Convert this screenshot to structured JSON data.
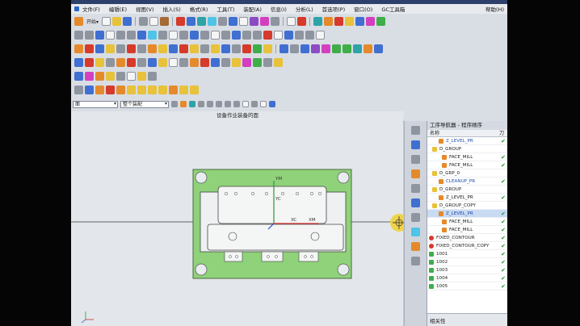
{
  "menu": {
    "items": [
      "文件(F)",
      "编辑(E)",
      "视图(V)",
      "插入(S)",
      "格式(R)",
      "工具(T)",
      "装配(A)",
      "信息(I)",
      "分析(L)",
      "首选项(P)",
      "窗口(O)",
      "GC工具箱",
      "帮助(H)"
    ]
  },
  "toolbar": {
    "start_label": "开始▾"
  },
  "filter": {
    "type_value": "面",
    "scope_value": "整个装配"
  },
  "viewport": {
    "title": "设备作业装备的面"
  },
  "triad": {
    "ym": "YM",
    "yc": "YC",
    "xc": "XC",
    "xm": "XM"
  },
  "navigator": {
    "title": "工序导航器 - 程序顺序",
    "col_name": "名称",
    "col_check": "刀",
    "rows": [
      {
        "label": "Z_LEVEL_PR",
        "indent": 14,
        "state": "ok",
        "highlight": true,
        "selected": false
      },
      {
        "label": "D_GROUP",
        "indent": 6,
        "state": "none",
        "highlight": false,
        "selected": false
      },
      {
        "label": "FACE_MILL",
        "indent": 18,
        "state": "ok",
        "highlight": false,
        "selected": false
      },
      {
        "label": "FACE_MILL",
        "indent": 18,
        "state": "ok",
        "highlight": false,
        "selected": false
      },
      {
        "label": "D_GRP_0",
        "indent": 6,
        "state": "none",
        "highlight": false,
        "selected": false
      },
      {
        "label": "CLEANUP_PR",
        "indent": 14,
        "state": "ok",
        "highlight": true,
        "selected": false
      },
      {
        "label": "D_GROUP",
        "indent": 6,
        "state": "none",
        "highlight": false,
        "selected": false
      },
      {
        "label": "Z_LEVEL_PR",
        "indent": 14,
        "state": "ok",
        "highlight": false,
        "selected": false
      },
      {
        "label": "D_GROUP_COPY",
        "indent": 6,
        "state": "none",
        "highlight": false,
        "selected": false
      },
      {
        "label": "Z_LEVEL_PR",
        "indent": 14,
        "state": "ok",
        "highlight": true,
        "selected": true
      },
      {
        "label": "FACE_MILL",
        "indent": 18,
        "state": "ok",
        "highlight": false,
        "selected": false
      },
      {
        "label": "FACE_MILL",
        "indent": 18,
        "state": "ok",
        "highlight": false,
        "selected": false
      },
      {
        "label": "FIXED_CONTOUR",
        "indent": 2,
        "state": "err",
        "highlight": false,
        "selected": false
      },
      {
        "label": "FIXED_CONTOUR_COPY",
        "indent": 2,
        "state": "err",
        "highlight": false,
        "selected": false
      },
      {
        "label": "1001",
        "indent": 2,
        "state": "ok2",
        "highlight": false,
        "selected": false
      },
      {
        "label": "1002",
        "indent": 2,
        "state": "ok2",
        "highlight": false,
        "selected": false
      },
      {
        "label": "1003",
        "indent": 2,
        "state": "ok2",
        "highlight": false,
        "selected": false
      },
      {
        "label": "1004",
        "indent": 2,
        "state": "ok2",
        "highlight": false,
        "selected": false
      },
      {
        "label": "1005",
        "indent": 2,
        "state": "ok2",
        "highlight": false,
        "selected": false
      }
    ],
    "footer_label": "相关性"
  },
  "colors": {
    "plate_green": "#8fd27a",
    "window_bg": "#d9dde4",
    "viewport_bg": "#e3e6ea",
    "axis_red": "#d02a2a",
    "axis_green": "#2a9a3a",
    "axis_blue": "#2a4fd0",
    "cursor_yellow": "#f0d23a"
  }
}
